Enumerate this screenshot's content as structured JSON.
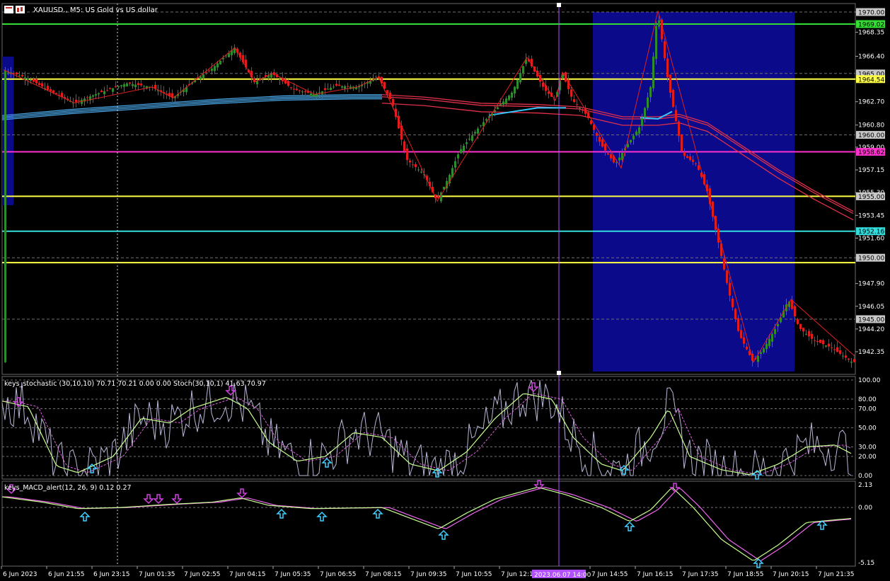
{
  "window": {
    "title": "XAUUSD., M5: US Gold vs US dollar"
  },
  "price_scale": {
    "labels": [
      "1970.00",
      "1968.35",
      "1966.40",
      "1964.54",
      "1962.70",
      "1960.80",
      "1959.00",
      "1957.15",
      "1955.30",
      "1953.45",
      "1951.60",
      "1950.00",
      "1947.90",
      "1946.05",
      "1944.20",
      "1942.35"
    ],
    "boxed_levels": [
      {
        "label": "1970.00",
        "value": 1970.0,
        "bg": "#c8c8c8",
        "fg": "#000000"
      },
      {
        "label": "1969.02",
        "value": 1969.02,
        "bg": "#33dd33",
        "fg": "#000000"
      },
      {
        "label": "1965.00",
        "value": 1965.0,
        "bg": "#c8c8c8",
        "fg": "#000000"
      },
      {
        "label": "1964.54",
        "value": 1964.54,
        "bg": "#ffff44",
        "fg": "#000000"
      },
      {
        "label": "1960.00",
        "value": 1960.0,
        "bg": "#c8c8c8",
        "fg": "#000000"
      },
      {
        "label": "1958.62",
        "value": 1958.62,
        "bg": "#ff33cc",
        "fg": "#000000"
      },
      {
        "label": "1955.00",
        "value": 1955.0,
        "bg": "#c8c8c8",
        "fg": "#000000"
      },
      {
        "label": "1952.16",
        "value": 1952.16,
        "bg": "#33dddd",
        "fg": "#000000"
      },
      {
        "label": "1950.00",
        "value": 1950.0,
        "bg": "#c8c8c8",
        "fg": "#000000"
      },
      {
        "label": "1945.00",
        "value": 1945.0,
        "bg": "#c8c8c8",
        "fg": "#000000"
      }
    ]
  },
  "horizontal_lines": [
    {
      "name": "green-level",
      "value": 1969.02,
      "color": "#33dd33"
    },
    {
      "name": "yellow-level",
      "value": 1964.54,
      "color": "#ffff44"
    },
    {
      "name": "magenta-level",
      "value": 1958.62,
      "color": "#ff33cc"
    },
    {
      "name": "yellow-dashed-level",
      "value": 1955.0,
      "color": "#ffff44"
    },
    {
      "name": "cyan-level",
      "value": 1952.16,
      "color": "#33dddd"
    },
    {
      "name": "yellow-low-level",
      "value": 1949.6,
      "color": "#ffff44"
    }
  ],
  "stochastic_panel": {
    "title": "keys_stochastic (30,10,10) 70.71 70.21 0.00 0.00 Stoch(30,10,1) 41.63 70.97",
    "scale_labels": [
      "100.00",
      "80.00",
      "70.00",
      "50.00",
      "30.00",
      "20.00",
      "0.00"
    ],
    "scale_values": [
      100,
      80,
      70,
      50,
      30,
      20,
      0
    ]
  },
  "macd_panel": {
    "title": "keys_MACD_alert(12, 26, 9) 0.12 0.27",
    "scale_labels": [
      "2.13",
      "0.00",
      "-5.15"
    ],
    "scale_values": [
      2.13,
      0,
      -5.15
    ]
  },
  "time_axis": {
    "labels": [
      "6 Jun 2023",
      "6 Jun 21:55",
      "6 Jun 23:15",
      "7 Jun 01:35",
      "7 Jun 02:55",
      "7 Jun 04:15",
      "7 Jun 05:35",
      "7 Jun 06:55",
      "7 Jun 08:15",
      "7 Jun 09:35",
      "7 Jun 10:55",
      "7 Jun 12:15",
      "7 Jun 14:55",
      "7 Jun 16:15",
      "7 Jun 17:35",
      "7 Jun 18:55",
      "7 Jun 20:15",
      "7 Jun 21:35"
    ],
    "crosshair_label": "2023.06.07 14:00"
  },
  "colors": {
    "bull": "#2e8b2e",
    "bear": "#e01c1c",
    "highlight_zone": "#0a0a8a",
    "crosshair": "#b050ff"
  }
}
